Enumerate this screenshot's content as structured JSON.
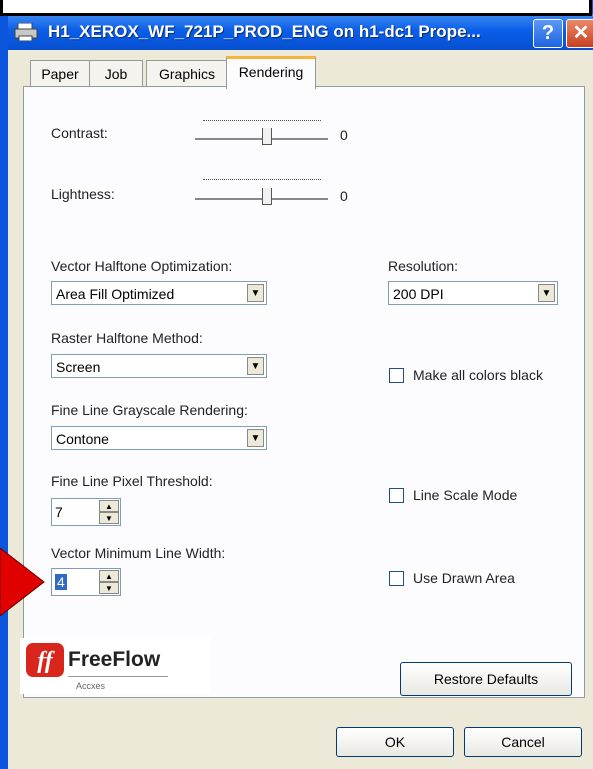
{
  "window": {
    "title": "H1_XEROX_WF_721P_PROD_ENG on h1-dc1 Prope...",
    "help_label": "?",
    "close_label": "✕"
  },
  "tabs": [
    {
      "label": "Paper",
      "active": false
    },
    {
      "label": "Job",
      "active": false
    },
    {
      "label": "Graphics",
      "active": false
    },
    {
      "label": "Rendering",
      "active": true
    }
  ],
  "contrast": {
    "label": "Contrast:",
    "value": "0"
  },
  "lightness": {
    "label": "Lightness:",
    "value": "0"
  },
  "vector_halftone": {
    "label": "Vector Halftone Optimization:",
    "value": "Area Fill Optimized"
  },
  "resolution": {
    "label": "Resolution:",
    "value": "200 DPI"
  },
  "raster_halftone": {
    "label": "Raster Halftone Method:",
    "value": "Screen"
  },
  "make_all_black": {
    "label": "Make all colors black",
    "checked": false
  },
  "fine_line_gray": {
    "label": "Fine Line Grayscale Rendering:",
    "value": "Contone"
  },
  "fine_line_threshold": {
    "label": "Fine Line Pixel Threshold:",
    "value": "7"
  },
  "line_scale_mode": {
    "label": "Line Scale Mode",
    "checked": false
  },
  "vector_min_width": {
    "label": "Vector Minimum Line Width:",
    "value": "4"
  },
  "use_drawn_area": {
    "label": "Use Drawn Area",
    "checked": false
  },
  "logo": {
    "name": "FreeFlow",
    "sub": "Accxes"
  },
  "buttons": {
    "restore": "Restore Defaults",
    "ok": "OK",
    "cancel": "Cancel"
  },
  "colors": {
    "titlebar": "#0a5ee8",
    "dialog_bg": "#ece9d8",
    "logo_red": "#d9261c",
    "arrow_red": "#e00000"
  }
}
